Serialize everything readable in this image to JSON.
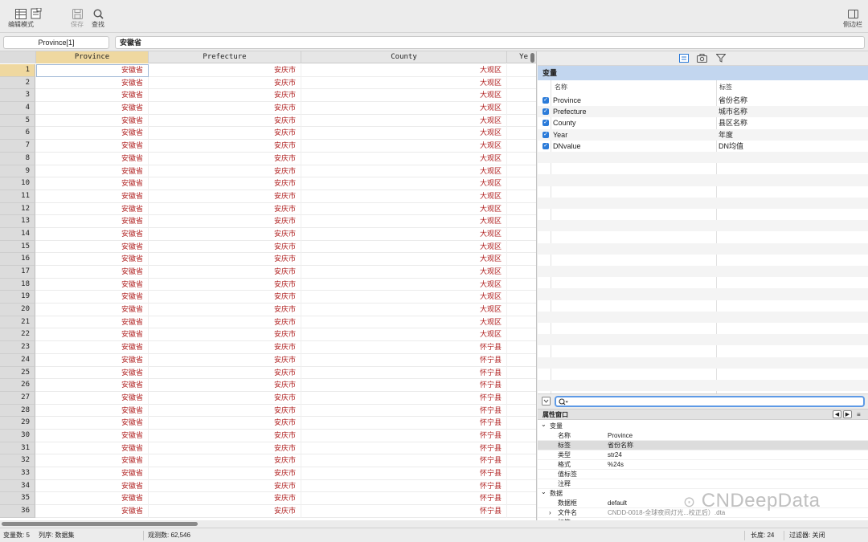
{
  "toolbar": {
    "edit_mode": "编辑模式",
    "variables_manager": "",
    "save": "保存",
    "find": "查找",
    "sidebar": "侧边栏"
  },
  "cmdbar": {
    "cell_ref": "Province[1]",
    "cell_value": "安徽省"
  },
  "grid": {
    "columns": [
      "Province",
      "Prefecture",
      "County",
      "Ye"
    ],
    "selected_column": "Province",
    "rows": [
      {
        "n": "1",
        "province": "安徽省",
        "prefecture": "安庆市",
        "county": "大观区"
      },
      {
        "n": "2",
        "province": "安徽省",
        "prefecture": "安庆市",
        "county": "大观区"
      },
      {
        "n": "3",
        "province": "安徽省",
        "prefecture": "安庆市",
        "county": "大观区"
      },
      {
        "n": "4",
        "province": "安徽省",
        "prefecture": "安庆市",
        "county": "大观区"
      },
      {
        "n": "5",
        "province": "安徽省",
        "prefecture": "安庆市",
        "county": "大观区"
      },
      {
        "n": "6",
        "province": "安徽省",
        "prefecture": "安庆市",
        "county": "大观区"
      },
      {
        "n": "7",
        "province": "安徽省",
        "prefecture": "安庆市",
        "county": "大观区"
      },
      {
        "n": "8",
        "province": "安徽省",
        "prefecture": "安庆市",
        "county": "大观区"
      },
      {
        "n": "9",
        "province": "安徽省",
        "prefecture": "安庆市",
        "county": "大观区"
      },
      {
        "n": "10",
        "province": "安徽省",
        "prefecture": "安庆市",
        "county": "大观区"
      },
      {
        "n": "11",
        "province": "安徽省",
        "prefecture": "安庆市",
        "county": "大观区"
      },
      {
        "n": "12",
        "province": "安徽省",
        "prefecture": "安庆市",
        "county": "大观区"
      },
      {
        "n": "13",
        "province": "安徽省",
        "prefecture": "安庆市",
        "county": "大观区"
      },
      {
        "n": "14",
        "province": "安徽省",
        "prefecture": "安庆市",
        "county": "大观区"
      },
      {
        "n": "15",
        "province": "安徽省",
        "prefecture": "安庆市",
        "county": "大观区"
      },
      {
        "n": "16",
        "province": "安徽省",
        "prefecture": "安庆市",
        "county": "大观区"
      },
      {
        "n": "17",
        "province": "安徽省",
        "prefecture": "安庆市",
        "county": "大观区"
      },
      {
        "n": "18",
        "province": "安徽省",
        "prefecture": "安庆市",
        "county": "大观区"
      },
      {
        "n": "19",
        "province": "安徽省",
        "prefecture": "安庆市",
        "county": "大观区"
      },
      {
        "n": "20",
        "province": "安徽省",
        "prefecture": "安庆市",
        "county": "大观区"
      },
      {
        "n": "21",
        "province": "安徽省",
        "prefecture": "安庆市",
        "county": "大观区"
      },
      {
        "n": "22",
        "province": "安徽省",
        "prefecture": "安庆市",
        "county": "大观区"
      },
      {
        "n": "23",
        "province": "安徽省",
        "prefecture": "安庆市",
        "county": "怀宁县"
      },
      {
        "n": "24",
        "province": "安徽省",
        "prefecture": "安庆市",
        "county": "怀宁县"
      },
      {
        "n": "25",
        "province": "安徽省",
        "prefecture": "安庆市",
        "county": "怀宁县"
      },
      {
        "n": "26",
        "province": "安徽省",
        "prefecture": "安庆市",
        "county": "怀宁县"
      },
      {
        "n": "27",
        "province": "安徽省",
        "prefecture": "安庆市",
        "county": "怀宁县"
      },
      {
        "n": "28",
        "province": "安徽省",
        "prefecture": "安庆市",
        "county": "怀宁县"
      },
      {
        "n": "29",
        "province": "安徽省",
        "prefecture": "安庆市",
        "county": "怀宁县"
      },
      {
        "n": "30",
        "province": "安徽省",
        "prefecture": "安庆市",
        "county": "怀宁县"
      },
      {
        "n": "31",
        "province": "安徽省",
        "prefecture": "安庆市",
        "county": "怀宁县"
      },
      {
        "n": "32",
        "province": "安徽省",
        "prefecture": "安庆市",
        "county": "怀宁县"
      },
      {
        "n": "33",
        "province": "安徽省",
        "prefecture": "安庆市",
        "county": "怀宁县"
      },
      {
        "n": "34",
        "province": "安徽省",
        "prefecture": "安庆市",
        "county": "怀宁县"
      },
      {
        "n": "35",
        "province": "安徽省",
        "prefecture": "安庆市",
        "county": "怀宁县"
      },
      {
        "n": "36",
        "province": "安徽省",
        "prefecture": "安庆市",
        "county": "怀宁县"
      }
    ]
  },
  "variables": {
    "header": "变量",
    "col_name": "名称",
    "col_label": "标签",
    "items": [
      {
        "name": "Province",
        "label": "省份名称"
      },
      {
        "name": "Prefecture",
        "label": "城市名称"
      },
      {
        "name": "County",
        "label": "县区名称"
      },
      {
        "name": "Year",
        "label": "年度"
      },
      {
        "name": "DNvalue",
        "label": "DN均值"
      }
    ]
  },
  "properties": {
    "header": "属性窗口",
    "var_section": "变量",
    "var_rows": [
      {
        "k": "名称",
        "v": "Province"
      },
      {
        "k": "标签",
        "v": "省份名称"
      },
      {
        "k": "类型",
        "v": "str24"
      },
      {
        "k": "格式",
        "v": "%24s"
      },
      {
        "k": "值标签",
        "v": ""
      },
      {
        "k": "注释",
        "v": ""
      }
    ],
    "data_section": "数据",
    "data_rows": [
      {
        "k": "数据框",
        "v": "default"
      },
      {
        "k": "文件名",
        "v": "CNDD-0018-全球夜间灯光...校正后）.dta"
      },
      {
        "k": "标签",
        "v": ""
      }
    ]
  },
  "status": {
    "varcount": "变量数: 5",
    "order": "列序: 数据集",
    "obs": "观测数: 62,546",
    "width": "长度: 24",
    "filter": "过滤器: 关闭"
  },
  "watermark": "CNDeepData",
  "colors": {
    "accent": "#2b7bd9",
    "value_text": "#b02020",
    "selected_col": "#efd8a0",
    "var_header": "#c2d6ef"
  }
}
